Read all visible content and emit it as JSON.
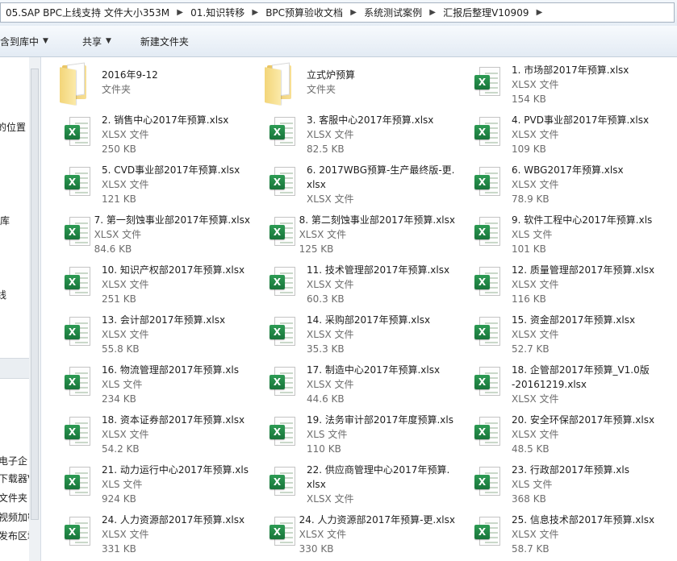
{
  "address": {
    "crumbs": [
      "05.SAP BPC上线支持 文件大小353M",
      "01.知识转移",
      "BPC预算验收文档",
      "系统测试案例",
      "汇报后整理V10909"
    ]
  },
  "toolbar": {
    "include_library": "含到库中",
    "share": "共享",
    "new_folder": "新建文件夹"
  },
  "nav": {
    "items": [
      "的位置",
      "库",
      "线",
      "电子企",
      "下载器V",
      "文件夹",
      "视频加密",
      "发布区域"
    ]
  },
  "files": [
    {
      "name": "2016年9-12",
      "type": "文件夹",
      "size": "",
      "kind": "folder"
    },
    {
      "name": "立式炉预算",
      "type": "文件夹",
      "size": "",
      "kind": "folder"
    },
    {
      "name": "1. 市场部2017年预算.xlsx",
      "type": "XLSX 文件",
      "size": "154 KB",
      "kind": "excel"
    },
    {
      "name": "2. 销售中心2017年预算.xlsx",
      "type": "XLSX 文件",
      "size": "250 KB",
      "kind": "excel"
    },
    {
      "name": "3. 客服中心2017年预算.xlsx",
      "type": "XLSX 文件",
      "size": "82.5 KB",
      "kind": "excel"
    },
    {
      "name": "4. PVD事业部2017年预算.xlsx",
      "type": "XLSX 文件",
      "size": "109 KB",
      "kind": "excel"
    },
    {
      "name": "5. CVD事业部2017年预算.xlsx",
      "type": "XLSX 文件",
      "size": "121 KB",
      "kind": "excel"
    },
    {
      "name": "6. 2017WBG预算-生产最终版-更.",
      "name2": "xlsx",
      "type": "XLSX 文件",
      "size": "",
      "kind": "excel"
    },
    {
      "name": "6. WBG2017年预算.xlsx",
      "type": "XLSX 文件",
      "size": "78.9 KB",
      "kind": "excel"
    },
    {
      "name": "7. 第一刻蚀事业部2017年预算.xlsx",
      "type": "XLSX 文件",
      "size": "84.6 KB",
      "kind": "excel"
    },
    {
      "name": "8. 第二刻蚀事业部2017年预算.xlsx",
      "type": "XLSX 文件",
      "size": "125 KB",
      "kind": "excel"
    },
    {
      "name": "9. 软件工程中心2017年预算.xls",
      "type": "XLS 文件",
      "size": "101 KB",
      "kind": "excel"
    },
    {
      "name": "10. 知识产权部2017年预算.xlsx",
      "type": "XLSX 文件",
      "size": "251 KB",
      "kind": "excel"
    },
    {
      "name": "11. 技术管理部2017年预算.xlsx",
      "type": "XLSX 文件",
      "size": "60.3 KB",
      "kind": "excel"
    },
    {
      "name": "12. 质量管理部2017年预算.xlsx",
      "type": "XLSX 文件",
      "size": "116 KB",
      "kind": "excel"
    },
    {
      "name": "13. 会计部2017年预算.xlsx",
      "type": "XLSX 文件",
      "size": "55.8 KB",
      "kind": "excel"
    },
    {
      "name": "14. 采购部2017年预算.xlsx",
      "type": "XLSX 文件",
      "size": "35.3 KB",
      "kind": "excel"
    },
    {
      "name": "15. 资金部2017年预算.xlsx",
      "type": "XLSX 文件",
      "size": "52.7 KB",
      "kind": "excel"
    },
    {
      "name": "16. 物流管理部2017年预算.xls",
      "type": "XLS 文件",
      "size": "234 KB",
      "kind": "excel"
    },
    {
      "name": "17. 制造中心2017年预算.xlsx",
      "type": "XLSX 文件",
      "size": "44.6 KB",
      "kind": "excel"
    },
    {
      "name": "18. 企管部2017年预算_V1.0版",
      "name2": "-20161219.xlsx",
      "type": "XLSX 文件",
      "size": "",
      "kind": "excel"
    },
    {
      "name": "18. 资本证券部2017年预算.xlsx",
      "type": "XLSX 文件",
      "size": "54.2 KB",
      "kind": "excel"
    },
    {
      "name": "19. 法务审计部2017年度预算.xls",
      "type": "XLS 文件",
      "size": "110 KB",
      "kind": "excel"
    },
    {
      "name": "20. 安全环保部2017年预算.xlsx",
      "type": "XLSX 文件",
      "size": "48.5 KB",
      "kind": "excel"
    },
    {
      "name": "21. 动力运行中心2017年预算.xls",
      "type": "XLS 文件",
      "size": "924 KB",
      "kind": "excel"
    },
    {
      "name": "22. 供应商管理中心2017年预算.",
      "name2": "xlsx",
      "type": "XLSX 文件",
      "size": "",
      "kind": "excel"
    },
    {
      "name": "23. 行政部2017年预算.xls",
      "type": "XLS 文件",
      "size": "368 KB",
      "kind": "excel"
    },
    {
      "name": "24. 人力资源部2017年预算.xlsx",
      "type": "XLSX 文件",
      "size": "331 KB",
      "kind": "excel"
    },
    {
      "name": "24. 人力资源部2017年预算-更.xlsx",
      "type": "XLSX 文件",
      "size": "330 KB",
      "kind": "excel"
    },
    {
      "name": "25. 信息技术部2017年预算.xlsx",
      "type": "XLSX 文件",
      "size": "58.7 KB",
      "kind": "excel"
    }
  ]
}
